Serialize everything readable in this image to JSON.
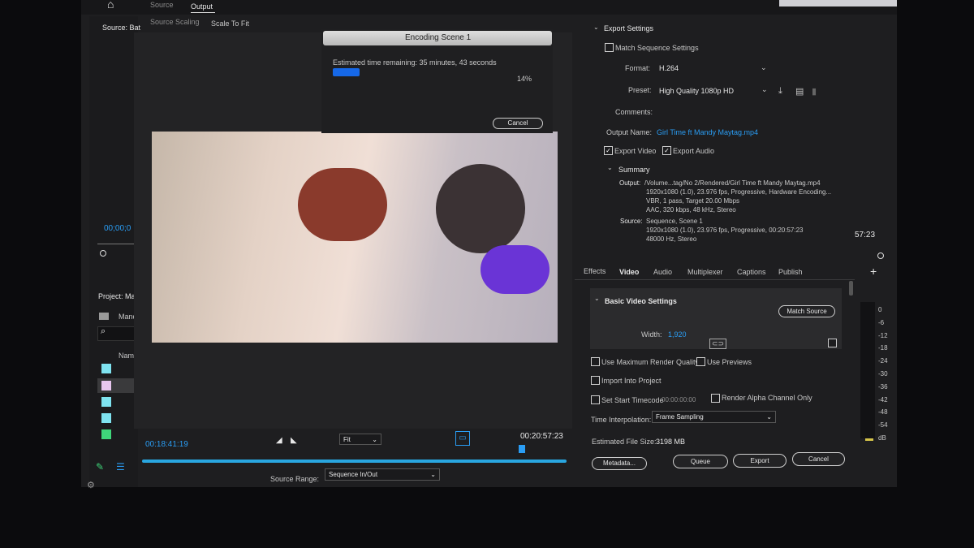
{
  "top_tabs": {
    "source": "Source",
    "output": "Output"
  },
  "output_sub": {
    "source_scaling_label": "Source Scaling",
    "scaling_value": "Scale To Fit"
  },
  "left_panel": {
    "source_tab": "Source: Bat",
    "timecode": "00;00;0",
    "project_title": "Project: Ma",
    "project_item": "Manc",
    "column_name": "Nam"
  },
  "encoding_dialog": {
    "title": "Encoding Scene 1",
    "time_remaining": "Estimated time remaining: 35 minutes, 43 seconds",
    "progress": 0.14,
    "percent_label": "14%",
    "cancel_label": "Cancel"
  },
  "preview": {
    "current_time": "00:18:41:19",
    "end_time": "00:20:57:23",
    "fit_value": "Fit",
    "source_range_label": "Source Range:",
    "source_range_value": "Sequence In/Out"
  },
  "export_settings": {
    "header": "Export Settings",
    "match_sequence": "Match Sequence Settings",
    "format_label": "Format:",
    "format_value": "H.264",
    "preset_label": "Preset:",
    "preset_value": "High Quality 1080p HD",
    "comments_label": "Comments:",
    "output_name_label": "Output Name:",
    "output_name_value": "Girl Time ft Mandy Maytag.mp4",
    "export_video": "Export Video",
    "export_audio": "Export Audio",
    "summary_header": "Summary",
    "output_label": "Output:",
    "output_lines": [
      "/Volume...tag/No 2/Rendered/Girl Time ft Mandy Maytag.mp4",
      "1920x1080 (1.0), 23.976 fps, Progressive, Hardware Encoding...",
      "VBR, 1 pass, Target 20.00 Mbps",
      "AAC, 320 kbps, 48 kHz, Stereo"
    ],
    "source_label": "Source:",
    "source_lines": [
      "Sequence, Scene 1",
      "1920x1080 (1.0), 23.976 fps, Progressive, 00:20:57:23",
      "48000 Hz, Stereo"
    ]
  },
  "tabs": [
    "Effects",
    "Video",
    "Audio",
    "Multiplexer",
    "Captions",
    "Publish"
  ],
  "video_settings": {
    "header": "Basic Video Settings",
    "match_source": "Match Source",
    "width_label": "Width:",
    "width_value": "1,920"
  },
  "render_options": {
    "max_render_quality": "Use Maximum Render Quality",
    "use_previews": "Use Previews",
    "import_into_project": "Import Into Project",
    "set_start_timecode": "Set Start Timecode",
    "start_timecode_value": "00:00:00:00",
    "render_alpha": "Render Alpha Channel Only",
    "time_interp_label": "Time Interpolation:",
    "time_interp_value": "Frame Sampling",
    "file_size_label": "Estimated File Size:",
    "file_size_value": "3198 MB"
  },
  "footer_buttons": {
    "metadata": "Metadata...",
    "queue": "Queue",
    "export": "Export",
    "cancel": "Cancel"
  },
  "right_strip": {
    "timecode": "57:23",
    "plus": "+"
  },
  "meter_ticks": [
    "0",
    "-6",
    "-12",
    "-18",
    "-24",
    "-30",
    "-36",
    "-42",
    "-48",
    "-54",
    "dB"
  ],
  "colors": {
    "accent": "#2a9df4",
    "swatches": [
      "#7fe3f0",
      "#e8c6ef",
      "#7fe3f0",
      "#7fe3f0",
      "#3fd67a"
    ]
  }
}
